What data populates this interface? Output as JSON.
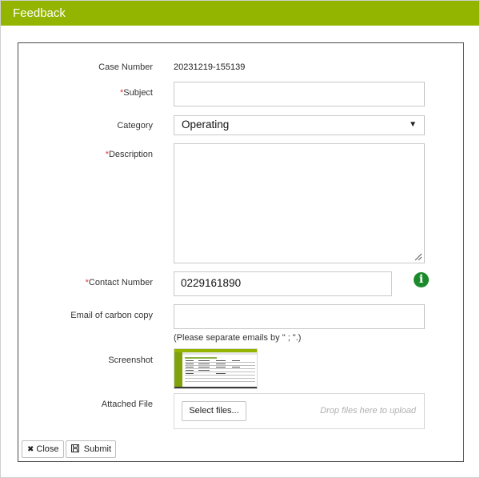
{
  "dialog": {
    "title": "Feedback"
  },
  "form": {
    "case_number": {
      "label": "Case Number",
      "value": "20231219-155139"
    },
    "subject": {
      "required_mark": "*",
      "label": "Subject",
      "value": ""
    },
    "category": {
      "label": "Category",
      "selected": "Operating",
      "arrow": "▼"
    },
    "description": {
      "required_mark": "*",
      "label": "Description",
      "value": ""
    },
    "contact_number": {
      "required_mark": "*",
      "label": "Contact Number",
      "value": "0229161890",
      "info_glyph": "i"
    },
    "email_cc": {
      "label": "Email of carbon copy",
      "value": "",
      "hint": "(Please separate emails by \" ; \".)"
    },
    "screenshot": {
      "label": "Screenshot"
    },
    "attached_file": {
      "label": "Attached File",
      "select_label": "Select files...",
      "drop_hint": "Drop files here to upload"
    }
  },
  "footer": {
    "close_label": "Close",
    "submit_label": "Submit"
  },
  "colors": {
    "brand": "#93b500",
    "info": "#1b8a2a",
    "required": "#e53935"
  },
  "icons": {
    "info": "info-icon",
    "close": "close-icon",
    "submit": "save-icon"
  }
}
